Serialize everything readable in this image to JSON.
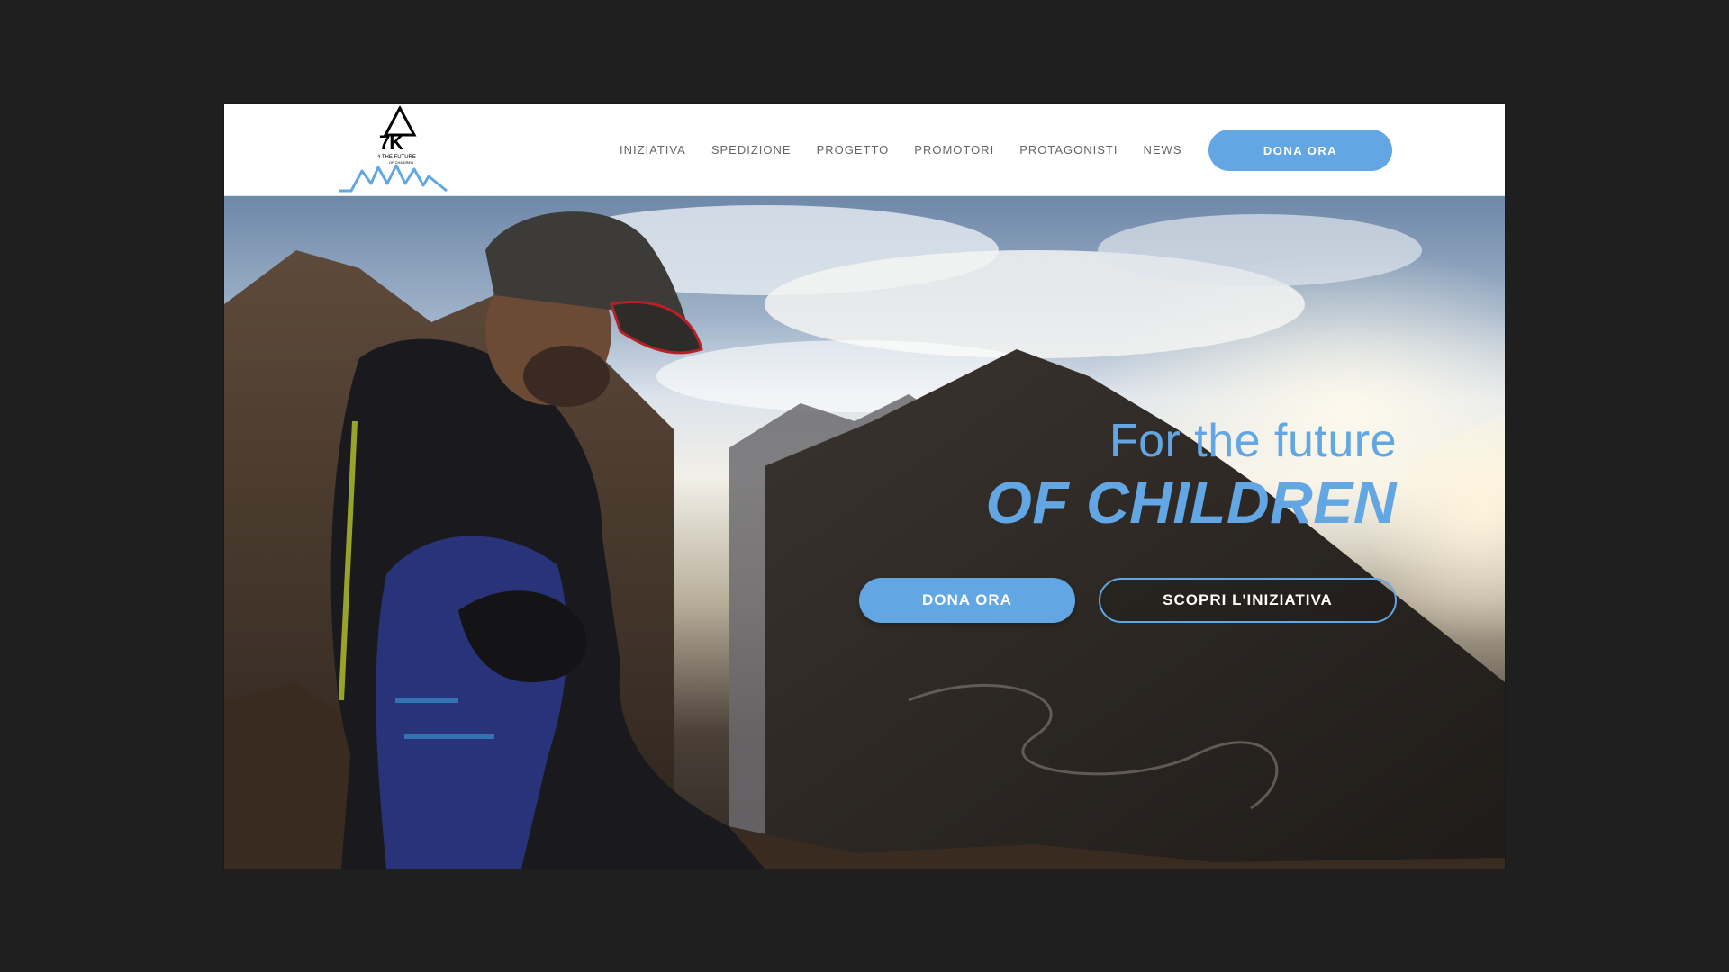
{
  "brand": {
    "logo_main": "7K",
    "logo_sub": "4 THE FUTURE",
    "logo_sub2": "OF CHILDREN",
    "accent_color": "#62a7e3"
  },
  "nav": {
    "items": [
      {
        "label": "INIZIATIVA"
      },
      {
        "label": "SPEDIZIONE"
      },
      {
        "label": "PROGETTO"
      },
      {
        "label": "PROMOTORI"
      },
      {
        "label": "PROTAGONISTI"
      },
      {
        "label": "NEWS"
      }
    ],
    "donate_label": "DONA ORA"
  },
  "hero": {
    "title_light": "For the future",
    "title_bold": "OF CHILDREN",
    "donate_label": "DONA ORA",
    "discover_label": "SCOPRI L'INIZIATIVA",
    "image_description_icon": "mountain-climber-photo"
  }
}
